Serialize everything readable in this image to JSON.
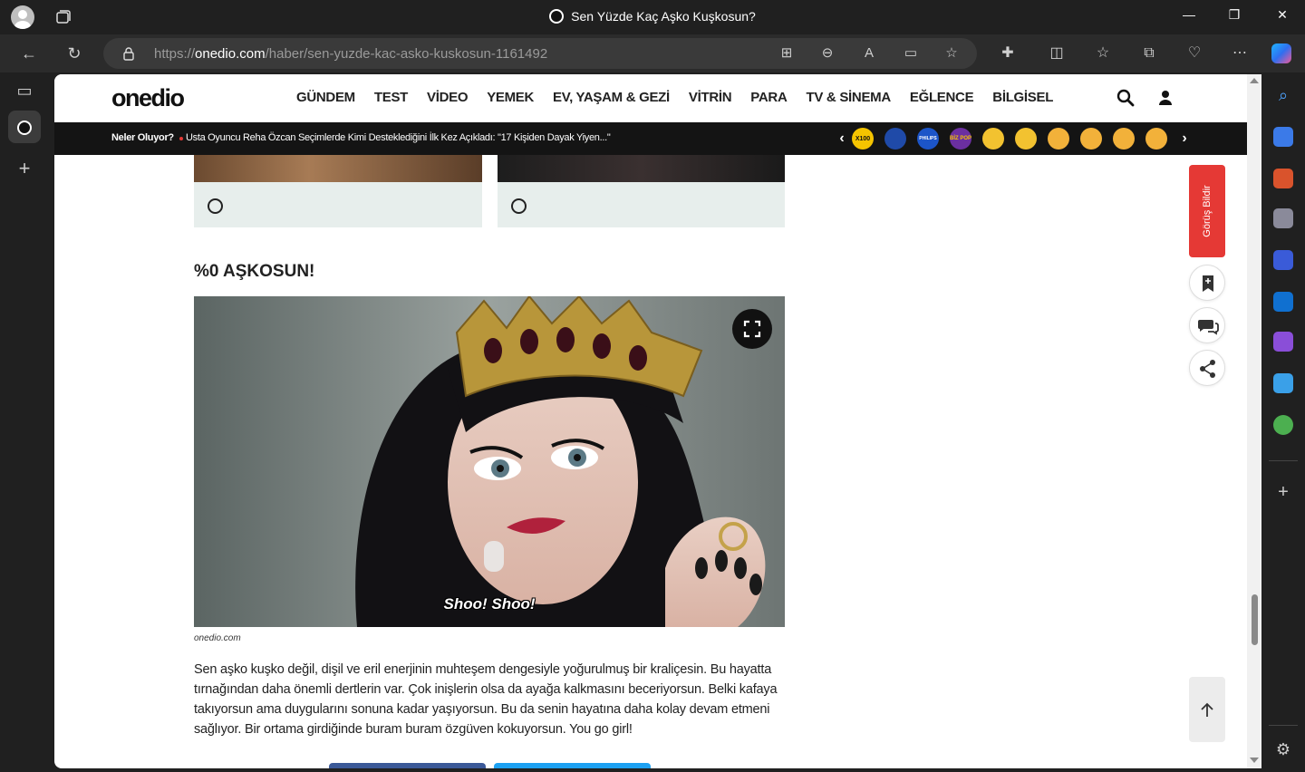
{
  "browser": {
    "window_title": "Sen Yüzde Kaç Aşko Kuşkosun?",
    "url_scheme": "https://",
    "url_domain": "onedio.com",
    "url_path": "/haber/sen-yuzde-kac-asko-kuskosun-1161492",
    "icons": [
      "profile-icon",
      "workspaces-icon",
      "back-icon",
      "refresh-icon",
      "lock-icon",
      "app-available-icon",
      "zoom-out-icon",
      "read-aloud-icon",
      "immersive-reader-icon",
      "favorite-star-icon",
      "extensions-icon",
      "split-screen-icon",
      "favorites-icon",
      "collections-icon",
      "browser-essentials-icon",
      "more-icon",
      "copilot-icon"
    ]
  },
  "site": {
    "logo": "onedio",
    "menu": [
      "GÜNDEM",
      "TEST",
      "VİDEO",
      "YEMEK",
      "EV, YAŞAM & GEZİ",
      "VİTRİN",
      "PARA",
      "TV & SİNEMA",
      "EĞLENCE",
      "BİLGİSEL"
    ],
    "ticker_label": "Neler Oluyor?",
    "ticker_text": "Usta Oyuncu Reha Özcan Seçimlerde Kimi Desteklediğini İlk Kez Açıkladı: \"17 Kişiden Dayak Yiyen...\"",
    "badges": [
      {
        "label": "X100",
        "color": "#f5c400"
      },
      {
        "label": "",
        "color": "#1f4aa8"
      },
      {
        "label": "PHILIPS",
        "color": "#1c55c8"
      },
      {
        "label": "BİZ POP",
        "color": "#6b2fa0"
      },
      {
        "label": "",
        "color": "#f2c230"
      },
      {
        "label": "",
        "color": "#f2c230"
      },
      {
        "label": "",
        "color": "#f2b13a"
      },
      {
        "label": "",
        "color": "#f2b13a"
      },
      {
        "label": "",
        "color": "#f2b13a"
      },
      {
        "label": "",
        "color": "#f2b13a"
      }
    ]
  },
  "article": {
    "result_title": "%0 AŞKOSUN!",
    "gif_caption": "Shoo! Shoo!",
    "image_source": "onedio.com",
    "body": "Sen aşko kuşko değil, dişil ve eril enerjinin muhteşem dengesiyle yoğurulmuş bir kraliçesin. Bu hayatta tırnağından daha önemli dertlerin var. Çok inişlerin olsa da ayağa kalkmasını beceriyorsun. Belki kafaya takıyorsun ama duygularını sonuna kadar yaşıyorsun. Bu da senin hayatına daha kolay devam etmeni sağlıyor. Bir ortama girdiğinde buram buram özgüven kokuyorsun. You go girl!"
  },
  "side": {
    "feedback_label": "Görüş Bildir"
  }
}
